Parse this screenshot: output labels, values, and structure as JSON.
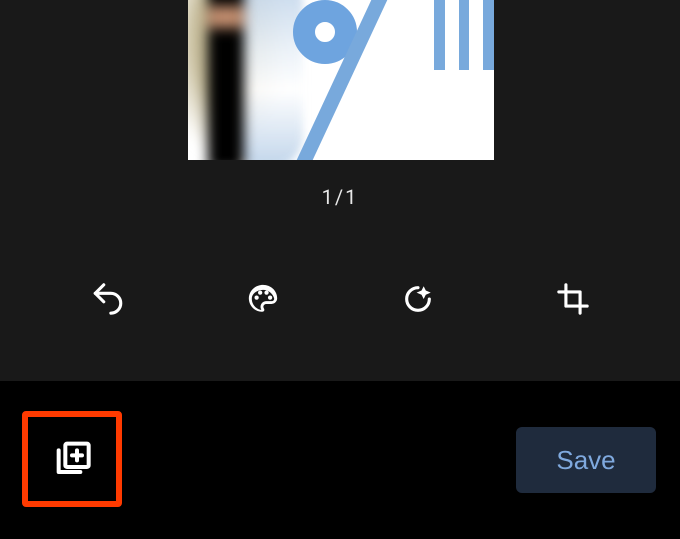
{
  "preview": {
    "counter": "1/1"
  },
  "toolbar": {
    "undo_name": "undo",
    "palette_name": "palette",
    "sparkle_name": "auto-enhance",
    "crop_name": "crop"
  },
  "bottom": {
    "add_name": "add-to-collage",
    "save_label": "Save"
  },
  "highlight": {
    "color": "#ff3a00"
  },
  "colors": {
    "background_dark": "#191919",
    "save_bg": "#1f2b3d",
    "save_text": "#7fa9de"
  }
}
